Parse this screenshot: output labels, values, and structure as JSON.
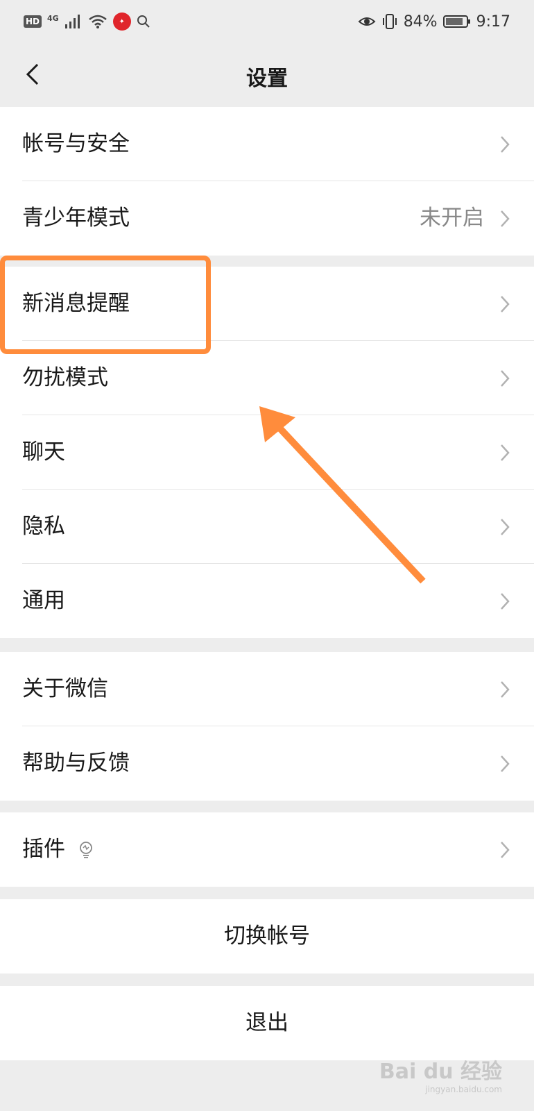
{
  "status_bar": {
    "left_badge": "HD",
    "network": "4G",
    "battery": "84%",
    "time": "9:17",
    "icons": [
      "signal-icon",
      "wifi-icon",
      "app-badge-icon",
      "search-icon",
      "eye-icon",
      "vibrate-icon",
      "battery-icon"
    ]
  },
  "header": {
    "title": "设置",
    "back_icon": "chevron-left-icon"
  },
  "groups": [
    {
      "items": [
        {
          "label": "帐号与安全",
          "value": ""
        },
        {
          "label": "青少年模式",
          "value": "未开启"
        }
      ]
    },
    {
      "items": [
        {
          "label": "新消息提醒"
        },
        {
          "label": "勿扰模式"
        },
        {
          "label": "聊天"
        },
        {
          "label": "隐私"
        },
        {
          "label": "通用"
        }
      ]
    },
    {
      "items": [
        {
          "label": "关于微信"
        },
        {
          "label": "帮助与反馈"
        }
      ]
    },
    {
      "items": [
        {
          "label": "插件"
        }
      ]
    }
  ],
  "actions": {
    "switch_account": "切换帐号",
    "logout": "退出"
  },
  "annotation": {
    "color": "#ff8c3c",
    "highlighted_item": "新消息提醒"
  },
  "watermark": {
    "brand": "Bai du 经验",
    "url": "jingyan.baidu.com"
  }
}
